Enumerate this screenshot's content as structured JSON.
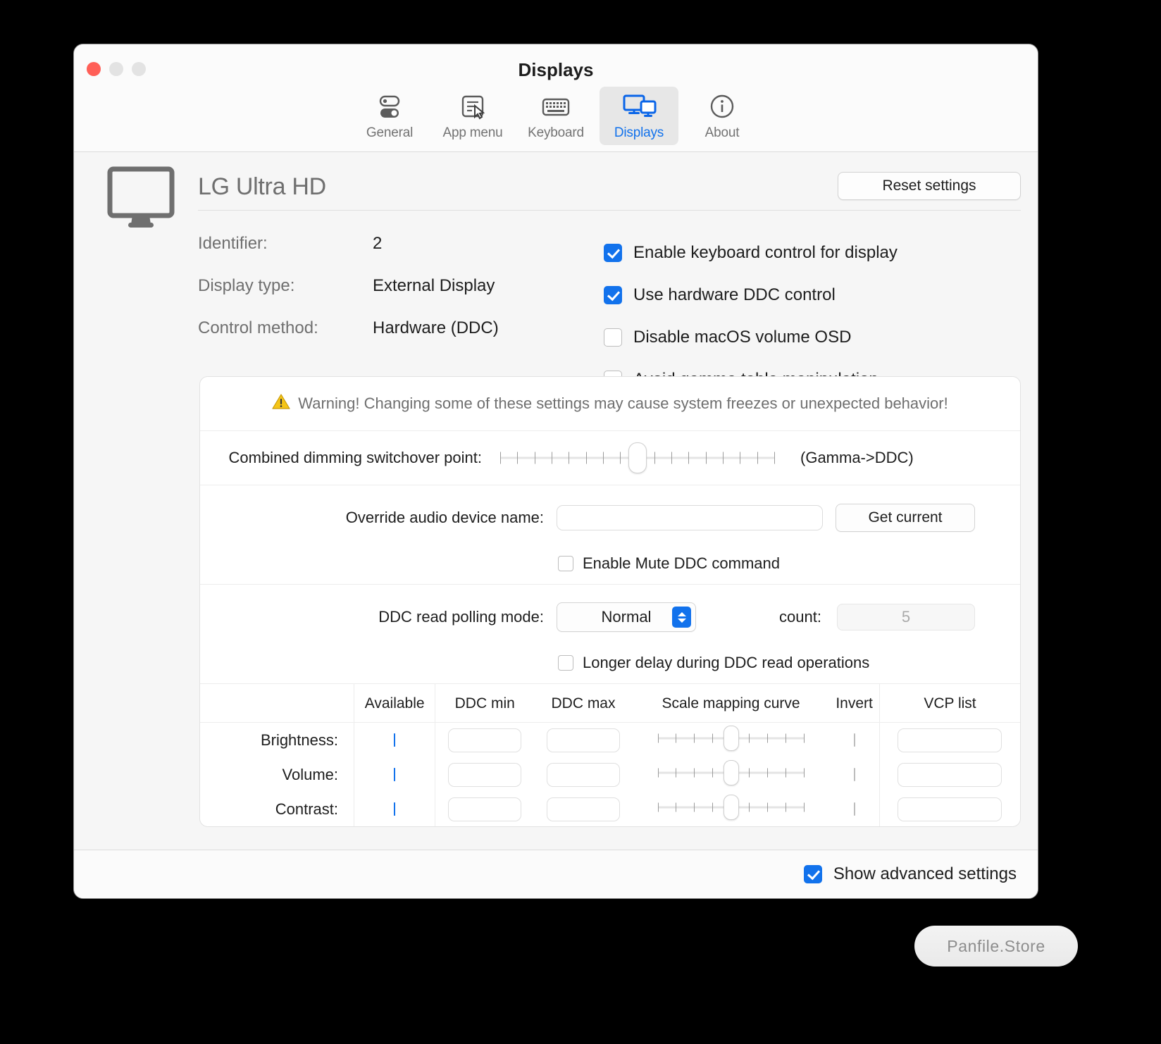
{
  "window": {
    "title": "Displays",
    "traffic_lights": [
      "close",
      "minimize",
      "zoom"
    ]
  },
  "toolbar": {
    "items": [
      {
        "label": "General",
        "icon": "toggles-icon",
        "active": false
      },
      {
        "label": "App menu",
        "icon": "app-menu-icon",
        "active": false
      },
      {
        "label": "Keyboard",
        "icon": "keyboard-icon",
        "active": false
      },
      {
        "label": "Displays",
        "icon": "displays-icon",
        "active": true
      },
      {
        "label": "About",
        "icon": "info-icon",
        "active": false
      }
    ]
  },
  "display": {
    "name": "LG Ultra HD",
    "icon": "monitor-icon",
    "reset_button": "Reset settings",
    "info": [
      {
        "key": "Identifier:",
        "value": "2"
      },
      {
        "key": "Display type:",
        "value": "External Display"
      },
      {
        "key": "Control method:",
        "value": "Hardware (DDC)"
      }
    ],
    "options": [
      {
        "label": "Enable keyboard control for display",
        "checked": true
      },
      {
        "label": "Use hardware DDC control",
        "checked": true
      },
      {
        "label": "Disable macOS volume OSD",
        "checked": false
      },
      {
        "label": "Avoid gamma table manipulation",
        "checked": false
      }
    ]
  },
  "advanced": {
    "warning_icon": "warning-triangle-icon",
    "warning_text": "Warning! Changing some of these settings may cause system freezes or unexpected behavior!",
    "dimming": {
      "label": "Combined dimming switchover point:",
      "suffix": "(Gamma->DDC)",
      "ticks": 17,
      "thumb_percent": 50
    },
    "audio": {
      "label": "Override audio device name:",
      "value": "",
      "placeholder": "",
      "button": "Get current",
      "mute_checkbox": {
        "label": "Enable Mute DDC command",
        "checked": false
      }
    },
    "polling": {
      "label": "DDC read polling mode:",
      "selected": "Normal",
      "options": [
        "Normal"
      ],
      "count_label": "count:",
      "count_value": "5",
      "delay_checkbox": {
        "label": "Longer delay during DDC read operations",
        "checked": false
      }
    },
    "table": {
      "headers": [
        "",
        "Available",
        "DDC min",
        "DDC max",
        "Scale mapping curve",
        "Invert",
        "VCP list"
      ],
      "rows": [
        {
          "label": "Brightness:",
          "available": true,
          "ddc_min": "",
          "ddc_max": "",
          "curve_ticks": 9,
          "curve_thumb_percent": 50,
          "invert": false,
          "vcp_list": ""
        },
        {
          "label": "Volume:",
          "available": true,
          "ddc_min": "",
          "ddc_max": "",
          "curve_ticks": 9,
          "curve_thumb_percent": 50,
          "invert": false,
          "vcp_list": ""
        },
        {
          "label": "Contrast:",
          "available": true,
          "ddc_min": "",
          "ddc_max": "",
          "curve_ticks": 9,
          "curve_thumb_percent": 50,
          "invert": false,
          "vcp_list": ""
        }
      ]
    }
  },
  "footer": {
    "show_advanced": {
      "label": "Show advanced settings",
      "checked": true
    }
  },
  "watermark": {
    "text": "Panfile.Store"
  },
  "colors": {
    "accent": "#1272ec",
    "close": "#ff5f57",
    "window_bg": "#f6f6f6",
    "panel_bg": "#ffffff",
    "muted_text": "#6f6f6f",
    "warning": "#f5c518"
  }
}
